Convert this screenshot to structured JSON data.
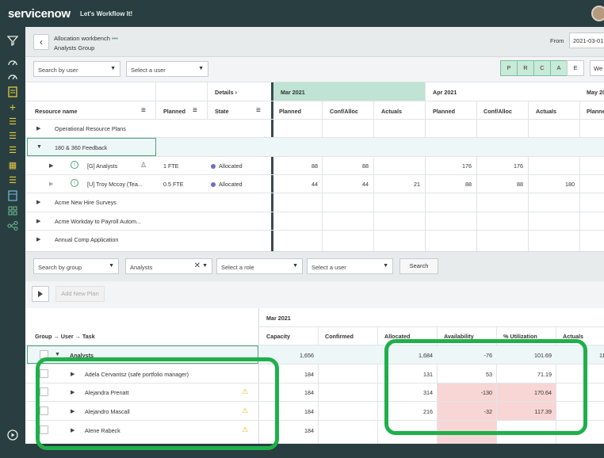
{
  "brand": {
    "logo": "servicenow",
    "tagline": "Let's Workflow It!"
  },
  "header": {
    "title": "Allocation workbench",
    "dots": "•••",
    "subtitle": "Analysts Group",
    "from_label": "From",
    "from_value": "2021-03-01"
  },
  "filters_top": {
    "search_by": "Search by user",
    "user_placeholder": "Select a user",
    "prcae": [
      "P",
      "R",
      "C",
      "A",
      "E"
    ],
    "week_btn": "We"
  },
  "grid_top": {
    "details": "Details",
    "col_resource": "Resource name",
    "col_planned": "Planned",
    "col_state": "State",
    "months": [
      "Mar 2021",
      "Apr 2021",
      "May 20"
    ],
    "sub_cols": [
      "Planned",
      "Conf/Alloc",
      "Actuals"
    ],
    "sub_cols_cut": "Planne",
    "rows": [
      {
        "name": "Operational Resource Plans",
        "planned": "",
        "state": "",
        "mar": [
          "",
          "",
          ""
        ],
        "apr": [
          "",
          "",
          ""
        ]
      },
      {
        "name": "180 & 360 Feedback",
        "planned": "",
        "state": "",
        "mar": [
          "",
          "",
          ""
        ],
        "apr": [
          "",
          "",
          ""
        ]
      },
      {
        "name": "[G] Analysts",
        "planned": "1 FTE",
        "state": "Allocated",
        "mar": [
          "88",
          "88",
          ""
        ],
        "apr": [
          "176",
          "176",
          ""
        ]
      },
      {
        "name": "[U] Troy Mccoy (Tea...",
        "planned": "0.5 FTE",
        "state": "Allocated",
        "mar": [
          "44",
          "44",
          "21"
        ],
        "apr": [
          "88",
          "88",
          "180"
        ]
      },
      {
        "name": "Acme New Hire Surveys",
        "planned": "",
        "state": "",
        "mar": [
          "",
          "",
          ""
        ],
        "apr": [
          "",
          "",
          ""
        ]
      },
      {
        "name": "Acme Workday to Payroll Autom...",
        "planned": "",
        "state": "",
        "mar": [
          "",
          "",
          ""
        ],
        "apr": [
          "",
          "",
          ""
        ]
      },
      {
        "name": "Annual Comp Application",
        "planned": "",
        "state": "",
        "mar": [
          "",
          "",
          ""
        ],
        "apr": [
          "",
          "",
          ""
        ]
      }
    ]
  },
  "filters_bottom": {
    "search_by": "Search by group",
    "group_value": "Analysts",
    "role_placeholder": "Select a role",
    "user_placeholder": "Select a user",
    "search_btn": "Search"
  },
  "toolbar_bottom": {
    "add_plan": "Add New Plan"
  },
  "grid_bottom": {
    "col_tree": "Group → User → Task",
    "month": "Mar 2021",
    "cols": [
      "Capacity",
      "Confirmed",
      "Allocated",
      "Availability",
      "% Utilization",
      "Actuals"
    ],
    "group_row": {
      "name": "Analysts",
      "values": [
        "1,656",
        "",
        "1,684",
        "-76",
        "101.69",
        ""
      ],
      "extra": "11"
    },
    "rows": [
      {
        "name": "Adela Cervantsz (safe portfolio manager)",
        "warn": false,
        "values": [
          "184",
          "",
          "131",
          "53",
          "71.19",
          ""
        ]
      },
      {
        "name": "Alejandra Prenatt",
        "warn": true,
        "values": [
          "184",
          "",
          "314",
          "-130",
          "170.64",
          ""
        ]
      },
      {
        "name": "Alejandro Mascall",
        "warn": true,
        "values": [
          "184",
          "",
          "216",
          "-32",
          "117.39",
          ""
        ]
      },
      {
        "name": "Alene Rabeck",
        "warn": true,
        "values": [
          "184",
          "",
          "",
          "",
          "",
          ""
        ]
      }
    ]
  },
  "colors": {
    "nav": "#293e40",
    "accent_green": "#1fb04b",
    "month_active": "#bfe3d5",
    "over_alloc": "#f8d6d6"
  }
}
